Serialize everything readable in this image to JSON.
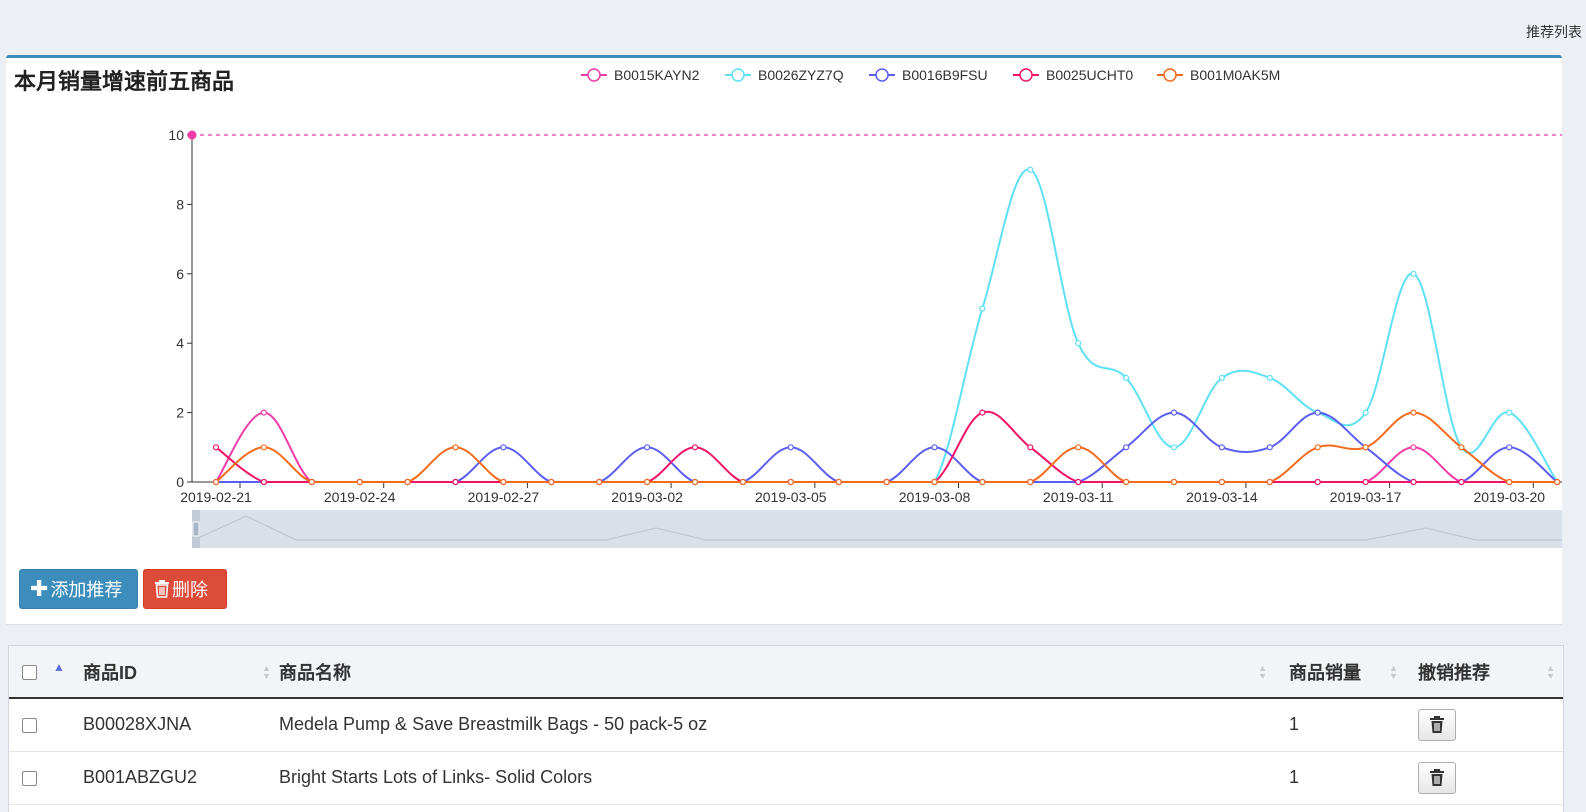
{
  "nav": {
    "recommend_list_link": "推荐列表"
  },
  "panel": {
    "title": "本月销量增速前五商品",
    "add_button_label": "添加推荐",
    "delete_button_label": "删除"
  },
  "colors": {
    "accent": "#3c8dbc",
    "danger": "#dd4b39",
    "series": [
      "#f13ba8",
      "#5ee0f5",
      "#5b5ef0",
      "#f01368",
      "#f36b1c"
    ],
    "markline": "#f13ba8"
  },
  "chart_data": {
    "type": "line",
    "smooth": true,
    "x": [
      "2019-02-21",
      "2019-02-22",
      "2019-02-23",
      "2019-02-24",
      "2019-02-25",
      "2019-02-26",
      "2019-02-27",
      "2019-02-28",
      "2019-03-01",
      "2019-03-02",
      "2019-03-03",
      "2019-03-04",
      "2019-03-05",
      "2019-03-06",
      "2019-03-07",
      "2019-03-08",
      "2019-03-09",
      "2019-03-10",
      "2019-03-11",
      "2019-03-12",
      "2019-03-13",
      "2019-03-14",
      "2019-03-15",
      "2019-03-16",
      "2019-03-17",
      "2019-03-18",
      "2019-03-19",
      "2019-03-20",
      "2019-03-21"
    ],
    "x_tick_labels": [
      "2019-02-21",
      "2019-02-24",
      "2019-02-27",
      "2019-03-02",
      "2019-03-05",
      "2019-03-08",
      "2019-03-11",
      "2019-03-14",
      "2019-03-17",
      "2019-03-20"
    ],
    "y_ticks": [
      0,
      2,
      4,
      6,
      8,
      10
    ],
    "ylim": [
      0,
      10
    ],
    "markline_value": 10,
    "legend_position": "top-center",
    "data_zoom": true,
    "series": [
      {
        "name": "B0015KAYN2",
        "values": [
          0,
          2,
          0,
          0,
          0,
          0,
          0,
          0,
          0,
          0,
          0,
          0,
          0,
          0,
          0,
          0,
          0,
          0,
          0,
          0,
          0,
          0,
          0,
          0,
          0,
          1,
          0,
          0,
          0
        ]
      },
      {
        "name": "B0026ZYZ7Q",
        "values": [
          0,
          0,
          0,
          0,
          0,
          0,
          0,
          0,
          0,
          0,
          0,
          0,
          0,
          0,
          0,
          0,
          5,
          9,
          4,
          3,
          1,
          3,
          3,
          2,
          2,
          6,
          1,
          2,
          0
        ]
      },
      {
        "name": "B0016B9FSU",
        "values": [
          0,
          0,
          0,
          0,
          0,
          0,
          1,
          0,
          0,
          1,
          0,
          0,
          1,
          0,
          0,
          1,
          0,
          0,
          0,
          1,
          2,
          1,
          1,
          2,
          1,
          0,
          0,
          1,
          0
        ]
      },
      {
        "name": "B0025UCHT0",
        "values": [
          1,
          0,
          0,
          0,
          0,
          0,
          0,
          0,
          0,
          0,
          1,
          0,
          0,
          0,
          0,
          0,
          2,
          1,
          0,
          0,
          0,
          0,
          0,
          0,
          0,
          0,
          0,
          0,
          0
        ]
      },
      {
        "name": "B001M0AK5M",
        "values": [
          0,
          1,
          0,
          0,
          0,
          1,
          0,
          0,
          0,
          0,
          0,
          0,
          0,
          0,
          0,
          0,
          0,
          0,
          1,
          0,
          0,
          0,
          0,
          1,
          1,
          2,
          1,
          0,
          0
        ]
      }
    ]
  },
  "table": {
    "headers": {
      "id": "商品ID",
      "name": "商品名称",
      "sales": "商品销量",
      "revoke": "撤销推荐"
    },
    "rows": [
      {
        "id": "B00028XJNA",
        "name": "Medela Pump & Save Breastmilk Bags - 50 pack-5 oz",
        "sales": "1"
      },
      {
        "id": "B001ABZGU2",
        "name": "Bright Starts Lots of Links- Solid Colors",
        "sales": "1"
      }
    ]
  }
}
